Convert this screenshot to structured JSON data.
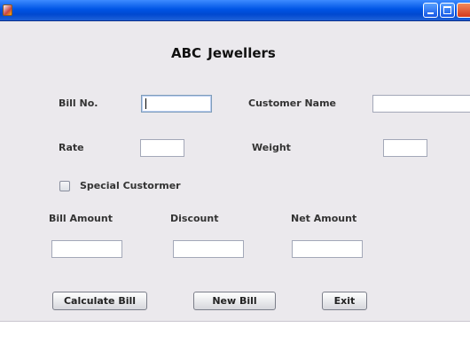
{
  "window": {
    "heading": "ABC  Jewellers"
  },
  "labels": {
    "bill_no": "Bill No.",
    "customer_name": "Customer Name",
    "rate": "Rate",
    "weight": "Weight",
    "special_customer": "Special Custormer",
    "bill_amount": "Bill Amount",
    "discount": "Discount",
    "net_amount": "Net Amount"
  },
  "fields": {
    "bill_no": "",
    "customer_name": "",
    "rate": "",
    "weight": "",
    "bill_amount": "",
    "discount": "",
    "net_amount": ""
  },
  "checkbox": {
    "special_customer_checked": false
  },
  "buttons": {
    "calculate": "Calculate Bill",
    "new_bill": "New Bill",
    "exit": "Exit"
  },
  "icons": {
    "app": "java-coffee-icon",
    "minimize": "minimize-icon",
    "maximize": "maximize-icon",
    "close": "close-icon"
  },
  "colors": {
    "titlebar": "#0055e5",
    "window_bg": "#ebe9ed",
    "label_text": "#333333"
  }
}
